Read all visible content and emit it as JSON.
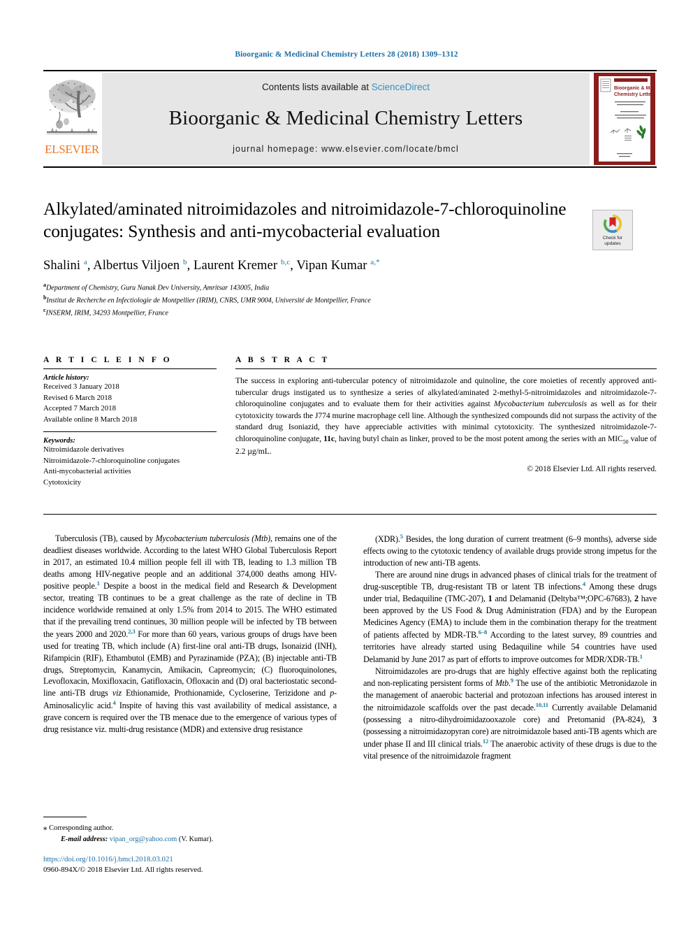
{
  "running_head": "Bioorganic & Medicinal Chemistry Letters 28 (2018) 1309–1312",
  "masthead": {
    "contents_prefix": "Contents lists available at ",
    "sciencedirect": "ScienceDirect",
    "journal_title": "Bioorganic & Medicinal Chemistry Letters",
    "homepage": "journal homepage: www.elsevier.com/locate/bmcl",
    "publisher_wordmark": "ELSEVIER",
    "cover_title_line1": "Bioorganic & Medicinal",
    "cover_title_line2": "Chemistry Letters"
  },
  "crossmark": {
    "line1": "Check for",
    "line2": "updates"
  },
  "article": {
    "title": "Alkylated/aminated nitroimidazoles and nitroimidazole-7-chloroquinoline conjugates: Synthesis and anti-mycobacterial evaluation",
    "authors_html": "Shalini <sup class=\"aff-mark\">a</sup>, Albertus Viljoen <sup class=\"aff-mark\">b</sup>, Laurent Kremer <sup class=\"aff-mark\">b,c</sup>, Vipan Kumar <sup class=\"aff-mark\">a,*</sup>",
    "affiliations": [
      {
        "label": "a",
        "text": "Department of Chemistry, Guru Nanak Dev University, Amritsar 143005, India"
      },
      {
        "label": "b",
        "text": "Institut de Recherche en Infectiologie de Montpellier (IRIM), CNRS, UMR 9004, Université de Montpellier, France"
      },
      {
        "label": "c",
        "text": "INSERM, IRIM, 34293 Montpellier, France"
      }
    ]
  },
  "article_info": {
    "heading": "A R T I C L E   I N F O",
    "history_label": "Article history:",
    "history": [
      "Received 3 January 2018",
      "Revised 6 March 2018",
      "Accepted 7 March 2018",
      "Available online 8 March 2018"
    ],
    "keywords_label": "Keywords:",
    "keywords": [
      "Nitroimidazole derivatives",
      "Nitroimidazole-7-chloroquinoline conjugates",
      "Anti-mycobacterial activities",
      "Cytotoxicity"
    ]
  },
  "abstract": {
    "heading": "A B S T R A C T",
    "text_html": "The success in exploring anti-tubercular potency of nitroimidazole and quinoline, the core moieties of recently approved anti-tubercular drugs instigated us to synthesize a series of alkylated/aminated 2-methyl-5-nitroimidazoles and nitroimidazole-7-chloroquinoline conjugates and to evaluate them for their activities against <i>Mycobacterium tuberculosis</i> as well as for their cytotoxicity towards the J774 murine macrophage cell line. Although the synthesized compounds did not surpass the activity of the standard drug Isoniazid, they have appreciable activities with minimal cytotoxicity. The synthesized nitroimidazole-7-chloroquinoline conjugate, <b>11c</b>, having butyl chain as linker, proved to be the most potent among the series with an MIC<sub>50</sub> value of 2.2 µg/mL.",
    "copyright": "© 2018 Elsevier Ltd. All rights reserved."
  },
  "body": {
    "left_column_html": [
      "Tuberculosis (TB), caused by <i>Mycobacterium tuberculosis (Mtb)</i>, remains one of the deadliest diseases worldwide. According to the latest WHO Global Tuberculosis Report in 2017, an estimated 10.4 million people fell ill with TB, leading to 1.3 million TB deaths among HIV-negative people and an additional 374,000 deaths among HIV-positive people.<span class=\"ref\">1</span> Despite a boost in the medical field and Research &amp; Development sector, treating TB continues to be a great challenge as the rate of decline in TB incidence worldwide remained at only 1.5% from 2014 to 2015. The WHO estimated that if the prevailing trend continues, 30 million people will be infected by TB between the years 2000 and 2020.<span class=\"ref\">2,3</span> For more than 60 years, various groups of drugs have been used for treating TB, which include (A) first-line oral anti-TB drugs, Isonaizid (INH), Rifampicin (RIF), Ethambutol (EMB) and Pyrazinamide (PZA); (B) injectable anti-TB drugs, Streptomycin, Kanamycin, Amikacin, Capreomycin; (C) fluoroquinolones, Levofloxacin, Moxifloxacin, Gatifloxacin, Ofloxacin and (D) oral bacteriostatic second-line anti-TB drugs <i>viz</i> Ethionamide, Prothionamide, Cycloserine, Terizidone and <i>p</i>-Aminosalicylic acid.<span class=\"ref\">4</span> Inspite of having this vast availability of medical assistance, a grave concern is required over the TB menace due to the emergence of various types of drug resistance viz. multi-drug resistance (MDR) and extensive drug resistance"
    ],
    "right_column_html": [
      "(XDR).<span class=\"ref\">5</span> Besides, the long duration of current treatment (6–9 months), adverse side effects owing to the cytotoxic tendency of available drugs provide strong impetus for the introduction of new anti-TB agents.",
      "There are around nine drugs in advanced phases of clinical trials for the treatment of drug-susceptible TB, drug-resistant TB or latent TB infections.<span class=\"ref\">4</span> Among these drugs under trial, Bedaquiline (TMC-207), <b>1</b> and Delamanid (Deltyba™;OPC-67683), <b>2</b> have been approved by the US Food &amp; Drug Administration (FDA) and by the European Medicines Agency (EMA) to include them in the combination therapy for the treatment of patients affected by MDR-TB.<span class=\"ref\">6–8</span> According to the latest survey, 89 countries and territories have already started using Bedaquiline while 54 countries have used Delamanid by June 2017 as part of efforts to improve outcomes for MDR/XDR-TB.<span class=\"ref\">1</span>",
      "Nitroimidazoles are pro-drugs that are highly effective against both the replicating and non-replicating persistent forms of <i>Mtb</i>.<span class=\"ref\">9</span> The use of the antibiotic Metronidazole in the management of anaerobic bacterial and protozoan infections has aroused interest in the nitroimidazole scaffolds over the past decade.<span class=\"ref\">10,11</span> Currently available Delamanid (possessing a nitro-dihydroimidazooxazole core) and Pretomanid (PA-824), <b>3</b> (possessing a nitroimidazopyran core) are nitroimidazole based anti-TB agents which are under phase II and III clinical trials.<span class=\"ref\">12</span> The anaerobic activity of these drugs is due to the vital presence of the nitroimidazole fragment"
    ]
  },
  "footnote": {
    "corresponding": "Corresponding author.",
    "email_label": "E-mail address:",
    "email": "vipan_org@yahoo.com",
    "email_suffix": "(V. Kumar)."
  },
  "footer": {
    "doi": "https://doi.org/10.1016/j.bmcl.2018.03.021",
    "issn_line": "0960-894X/© 2018 Elsevier Ltd. All rights reserved."
  },
  "colors": {
    "link_blue": "#1c6ea4",
    "sciencedirect_blue": "#3a8fc0",
    "ref_teal": "#1a7a9a",
    "elsevier_orange": "#ee7623",
    "cover_red": "#8c1d1d",
    "banner_gray": "#e6e6e6"
  }
}
